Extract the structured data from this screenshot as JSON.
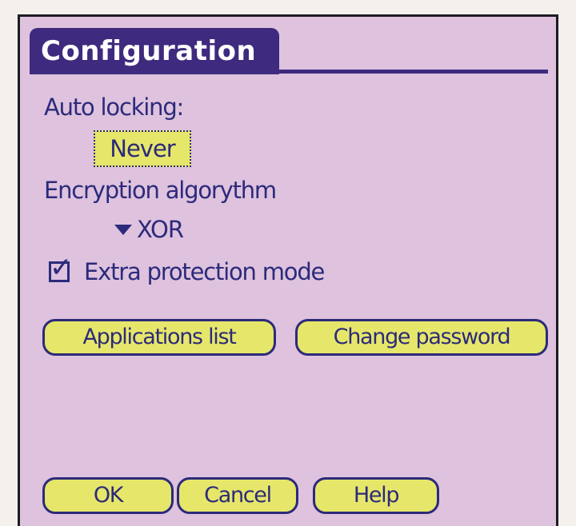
{
  "form": {
    "title": "Configuration"
  },
  "auto_locking": {
    "label": "Auto locking:",
    "value": "Never"
  },
  "encryption": {
    "label": "Encryption algorythm",
    "value": "XOR"
  },
  "extra_protection": {
    "label": "Extra protection mode",
    "checked": true
  },
  "buttons": {
    "applications_list": "Applications list",
    "change_password": "Change password",
    "ok": "OK",
    "cancel": "Cancel",
    "help": "Help"
  },
  "colors": {
    "background": "#dec2de",
    "title_bar": "#3e2a7e",
    "button_fill": "#e6e66a",
    "text": "#2c2a7a"
  }
}
